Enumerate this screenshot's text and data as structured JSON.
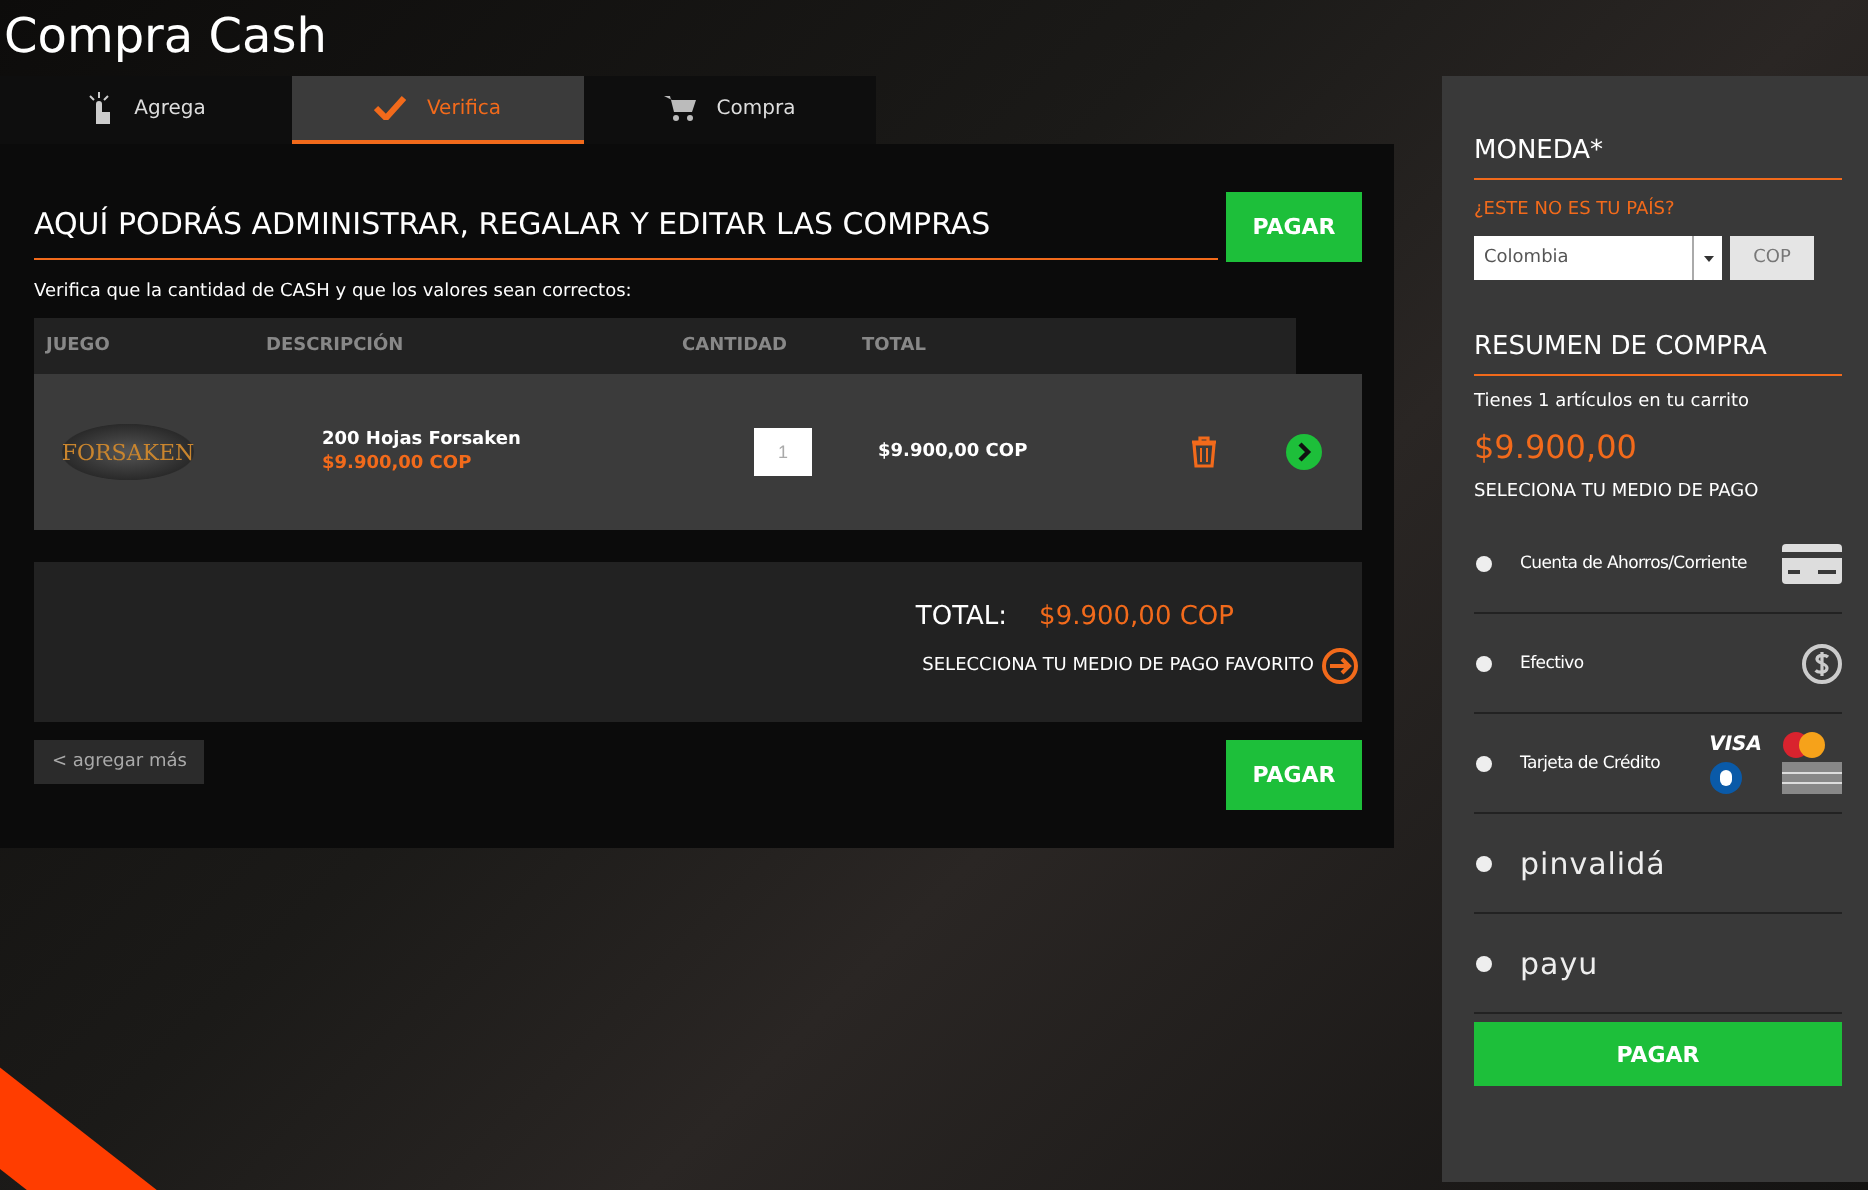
{
  "page_title": "Compra Cash",
  "tabs": [
    {
      "label": "Agrega",
      "selected": false
    },
    {
      "label": "Verifica",
      "selected": true
    },
    {
      "label": "Compra",
      "selected": false
    }
  ],
  "heading": "AQUÍ PODRÁS ADMINISTRAR, REGALAR Y EDITAR LAS COMPRAS",
  "subtitle": "Verifica que la cantidad de CASH y que los valores sean correctos:",
  "top_button": "PAGAR",
  "table": {
    "columns": [
      "JUEGO",
      "DESCRIPCIÓN",
      "CANTIDAD",
      "TOTAL"
    ],
    "rows": [
      {
        "game_logo": "FORSAKEN",
        "name": "200 Hojas Forsaken",
        "price": "$9.900,00 COP",
        "quantity": "1",
        "total": "$9.900,00 COP"
      }
    ]
  },
  "summary": {
    "label": "TOTAL:",
    "amount": "$9.900,00 COP",
    "hint": "SELECCIONA TU MEDIO DE PAGO FAVORITO"
  },
  "back_link": "< agregar más",
  "bottom_button": "PAGAR",
  "sidebar": {
    "currency_title": "MONEDA*",
    "country_link": "¿ESTE NO ES TU PAÍS?",
    "country": "Colombia",
    "currency": "COP",
    "summary_title": "RESUMEN DE COMPRA",
    "cart_text": "Tienes 1 artículos en tu carrito",
    "amount": "$9.900,00",
    "method_title": "SELECIONA TU MEDIO DE PAGO",
    "methods": [
      {
        "kind": "bank",
        "label": "Cuenta de Ahorros/Corriente",
        "selected": false
      },
      {
        "kind": "cash",
        "label": "Efectivo",
        "selected": false
      },
      {
        "kind": "card",
        "label": "Tarjeta de Crédito",
        "brand": "VISA",
        "selected": false
      },
      {
        "kind": "logo",
        "label": "pinvalidá",
        "selected": false
      },
      {
        "kind": "logo",
        "label": "payu",
        "selected": false
      }
    ],
    "button": "PAGAR"
  }
}
